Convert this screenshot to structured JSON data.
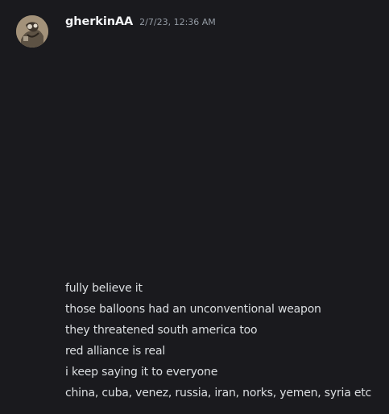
{
  "message": {
    "username": "gherkinAA",
    "timestamp": "2/7/23, 12:36 AM",
    "avatar": "user-avatar-image",
    "lines": [
      "fully believe it",
      "those balloons had an unconventional weapon",
      "they threatened south america too",
      "red alliance is real",
      "i keep saying it to everyone",
      "china, cuba, venez, russia, iran, norks, yemen, syria etc"
    ]
  },
  "colors": {
    "background": "#1a1a1e",
    "username": "#f2f3f5",
    "timestamp": "#949ba4",
    "message_text": "#dbdee1"
  }
}
